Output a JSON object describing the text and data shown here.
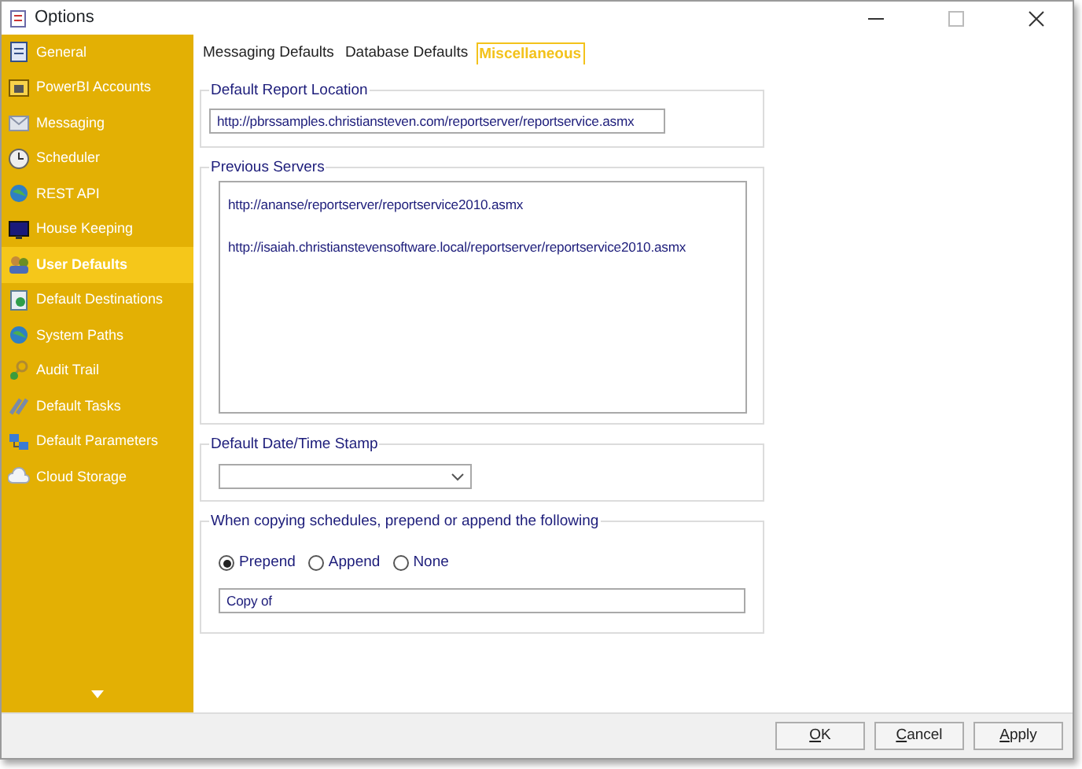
{
  "window": {
    "title": "Options"
  },
  "sidebar": {
    "items": [
      {
        "label": "General",
        "selected": false
      },
      {
        "label": "PowerBI Accounts",
        "selected": false
      },
      {
        "label": "Messaging",
        "selected": false
      },
      {
        "label": "Scheduler",
        "selected": false
      },
      {
        "label": "REST API",
        "selected": false
      },
      {
        "label": "House Keeping",
        "selected": false
      },
      {
        "label": "User Defaults",
        "selected": true
      },
      {
        "label": "Default Destinations",
        "selected": false
      },
      {
        "label": "System Paths",
        "selected": false
      },
      {
        "label": "Audit Trail",
        "selected": false
      },
      {
        "label": "Default Tasks",
        "selected": false
      },
      {
        "label": "Default Parameters",
        "selected": false
      },
      {
        "label": "Cloud Storage",
        "selected": false
      }
    ]
  },
  "tabs": [
    {
      "label": "Messaging Defaults",
      "selected": false
    },
    {
      "label": "Database Defaults",
      "selected": false
    },
    {
      "label": "Miscellaneous",
      "selected": true
    }
  ],
  "default_report_location": {
    "title": "Default Report Location",
    "value": "http://pbrssamples.christiansteven.com/reportserver/reportservice.asmx"
  },
  "previous_servers": {
    "title": "Previous Servers",
    "items": [
      "http://ananse/reportserver/reportservice2010.asmx",
      "http://isaiah.christianstevensoftware.local/reportserver/reportservice2010.asmx"
    ]
  },
  "date_time_stamp": {
    "title": "Default Date/Time Stamp"
  },
  "copy_schedules": {
    "title": "When copying schedules, prepend or append the following",
    "options": [
      {
        "label": "Prepend",
        "selected": true
      },
      {
        "label": "Append",
        "selected": false
      },
      {
        "label": "None",
        "selected": false
      }
    ],
    "value": "Copy of"
  },
  "buttons": [
    {
      "label": "OK"
    },
    {
      "label": "Cancel"
    },
    {
      "label": "Apply"
    }
  ]
}
